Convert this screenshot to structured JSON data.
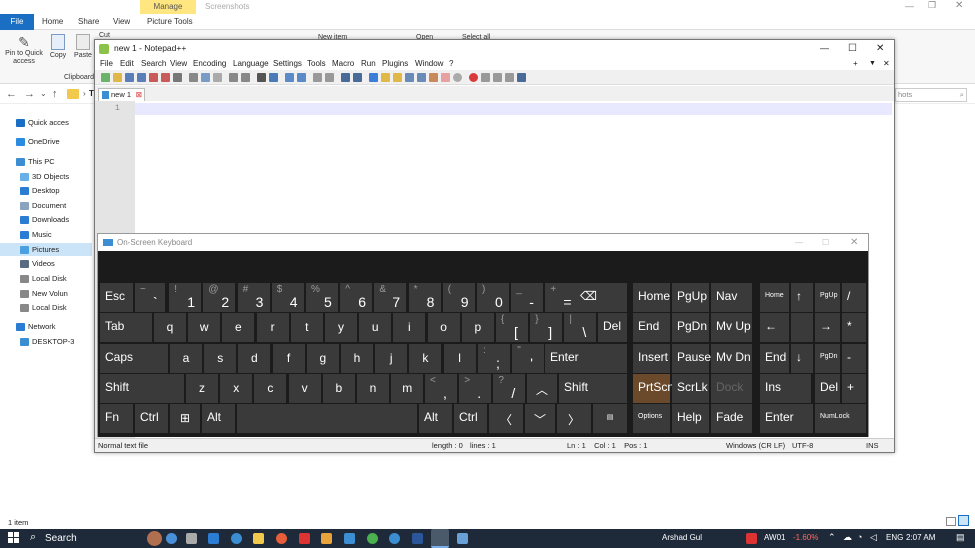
{
  "explorer": {
    "manage_tab": "Manage",
    "title": "Screenshots",
    "tabs": [
      "File",
      "Home",
      "Share",
      "View",
      "Picture Tools"
    ],
    "ribbon": {
      "pin_label_1": "Pin to Quick",
      "pin_label_2": "access",
      "copy": "Copy",
      "paste": "Paste",
      "cut": "Cut",
      "clipboard": "Clipboard",
      "new_item": "New item",
      "open": "Open",
      "select_all": "Select all"
    },
    "breadcrumb_partial": "Th",
    "search_placeholder": "hots",
    "nav": [
      "Quick acces",
      "OneDrive",
      "This PC",
      "3D Objects",
      "Desktop",
      "Document",
      "Downloads",
      "Music",
      "Pictures",
      "Videos",
      "Local Disk",
      "New Volun",
      "Local Disk",
      "Network",
      "DESKTOP-3"
    ],
    "status": "1 item"
  },
  "notepad": {
    "title": "new 1 - Notepad++",
    "menu": [
      "File",
      "Edit",
      "Search",
      "View",
      "Encoding",
      "Language",
      "Settings",
      "Tools",
      "Macro",
      "Run",
      "Plugins",
      "Window",
      "?"
    ],
    "tab_label": "new 1",
    "line_number": "1",
    "status": {
      "type": "Normal text file",
      "length": "length : 0",
      "lines": "lines : 1",
      "pos": "Ln : 1    Col : 1    Pos : 1",
      "eol": "Windows (CR LF)",
      "encoding": "UTF-8",
      "mode": "INS"
    }
  },
  "osk": {
    "title": "On-Screen Keyboard",
    "row1": [
      {
        "u": "~",
        "d": "`",
        "label": "Esc"
      },
      {
        "u": "!",
        "d": "1"
      },
      {
        "u": "@",
        "d": "2"
      },
      {
        "u": "#",
        "d": "3"
      },
      {
        "u": "$",
        "d": "4"
      },
      {
        "u": "%",
        "d": "5"
      },
      {
        "u": "^",
        "d": "6"
      },
      {
        "u": "&",
        "d": "7"
      },
      {
        "u": "*",
        "d": "8"
      },
      {
        "u": "(",
        "d": "9"
      },
      {
        "u": ")",
        "d": "0"
      },
      {
        "u": "_",
        "d": "-"
      },
      {
        "u": "+",
        "d": "="
      }
    ],
    "row2": [
      "Tab",
      "q",
      "w",
      "e",
      "r",
      "t",
      "y",
      "u",
      "i",
      "o",
      "p"
    ],
    "row2_extra": [
      {
        "u": "{",
        "d": "["
      },
      {
        "u": "}",
        "d": "]"
      },
      {
        "u": "|",
        "d": "\\"
      }
    ],
    "row3": [
      "Caps",
      "a",
      "s",
      "d",
      "f",
      "g",
      "h",
      "j",
      "k",
      "l"
    ],
    "row3_extra": [
      {
        "u": ":",
        "d": ";"
      },
      {
        "u": "\"",
        "d": "'"
      }
    ],
    "row4": [
      "Shift",
      "z",
      "x",
      "c",
      "v",
      "b",
      "n",
      "m"
    ],
    "row4_extra": [
      {
        "u": "<",
        "d": ","
      },
      {
        "u": ">",
        "d": "."
      },
      {
        "u": "?",
        "d": "/"
      }
    ],
    "labels": {
      "del": "Del",
      "enter": "Enter",
      "shift": "Shift",
      "fn": "Fn",
      "ctrl": "Ctrl",
      "alt": "Alt",
      "home": "Home",
      "pgup": "PgUp",
      "nav": "Nav",
      "end": "End",
      "pgdn": "PgDn",
      "mvup": "Mv Up",
      "insert": "Insert",
      "pause": "Pause",
      "mvdn": "Mv Dn",
      "prtscn": "PrtScn",
      "scrlk": "ScrLk",
      "dock": "Dock",
      "options": "Options",
      "help": "Help",
      "fade": "Fade",
      "np_home": "Home",
      "np_pgup": "PgUp",
      "np_slash": "/",
      "np_left": "←",
      "np_right": "→",
      "np_star": "*",
      "np_end": "End",
      "np_pgdn": "PgDn",
      "np_minus": "-",
      "np_ins": "Ins",
      "np_del": "Del",
      "np_plus": "+",
      "np_enter": "Enter",
      "numlock": "NumLock",
      "up_arrow": "↑",
      "down_arrow": "↓"
    }
  },
  "taskbar": {
    "search": "Search",
    "user": "Arshad Gul",
    "ticker": "AW01",
    "change": "-1.60%",
    "lang": "ENG",
    "time": "2:07 AM"
  }
}
